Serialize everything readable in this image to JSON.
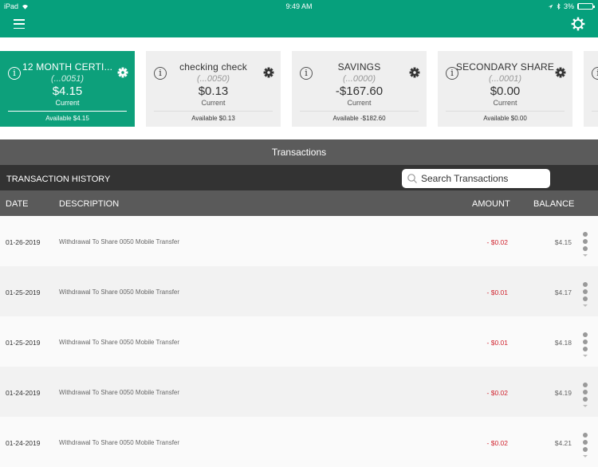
{
  "status_bar": {
    "device": "iPad",
    "time": "9:49 AM",
    "battery": "3%",
    "battery_level": 0.03
  },
  "header": {
    "menu_icon": "hamburger-menu-icon",
    "settings_icon": "gear-outline-icon"
  },
  "accounts": [
    {
      "name": "12 MONTH CERTI...",
      "number": "(...0051)",
      "balance": "$4.15",
      "balance_label": "Current",
      "available": "Available $4.15",
      "active": true
    },
    {
      "name": "checking check",
      "number": "(...0050)",
      "balance": "$0.13",
      "balance_label": "Current",
      "available": "Available $0.13",
      "active": false
    },
    {
      "name": "SAVINGS",
      "number": "(...0000)",
      "balance": "-$167.60",
      "balance_label": "Current",
      "available": "Available -$182.60",
      "active": false
    },
    {
      "name": "SECONDARY SHARE",
      "number": "(...0001)",
      "balance": "$0.00",
      "balance_label": "Current",
      "available": "Available $0.00",
      "active": false
    }
  ],
  "transactions": {
    "title": "Transactions",
    "history_label": "TRANSACTION HISTORY",
    "search_placeholder": "Search Transactions",
    "columns": {
      "date": "DATE",
      "description": "DESCRIPTION",
      "amount": "AMOUNT",
      "balance": "BALANCE"
    },
    "rows": [
      {
        "date": "01-26-2019",
        "description": "Withdrawal To Share 0050 Mobile Transfer",
        "amount": "- $0.02",
        "balance": "$4.15"
      },
      {
        "date": "01-25-2019",
        "description": "Withdrawal To Share 0050 Mobile Transfer",
        "amount": "- $0.01",
        "balance": "$4.17"
      },
      {
        "date": "01-25-2019",
        "description": "Withdrawal To Share 0050 Mobile Transfer",
        "amount": "- $0.01",
        "balance": "$4.18"
      },
      {
        "date": "01-24-2019",
        "description": "Withdrawal To Share 0050 Mobile Transfer",
        "amount": "- $0.02",
        "balance": "$4.19"
      },
      {
        "date": "01-24-2019",
        "description": "Withdrawal To Share 0050 Mobile Transfer",
        "amount": "- $0.02",
        "balance": "$4.21"
      }
    ]
  },
  "colors": {
    "brand": "#06a07c",
    "negative": "#d0232e"
  }
}
